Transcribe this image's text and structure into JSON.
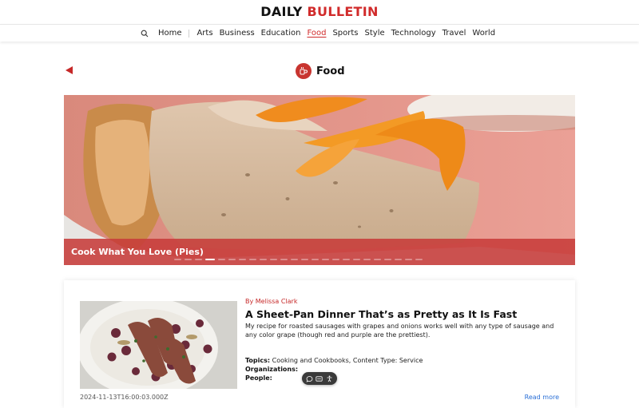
{
  "masthead": {
    "part1": "DAILY ",
    "part2": "BULLETIN"
  },
  "nav": {
    "home": "Home",
    "items": [
      "Arts",
      "Business",
      "Education",
      "Food",
      "Sports",
      "Style",
      "Technology",
      "Travel",
      "World"
    ],
    "active": "Food"
  },
  "section": {
    "title": "Food",
    "icon": "food-icon"
  },
  "hero": {
    "caption": "Cook What You Love (Pies)",
    "slide_count": 24,
    "active_slide": 3
  },
  "article": {
    "byline": "By Melissa Clark",
    "headline": "A Sheet-Pan Dinner That’s as Pretty as It Is Fast",
    "summary": "My recipe for roasted sausages with grapes and onions works well with any type of sausage and any color grape (though red and purple are the prettiest).",
    "topics_label": "Topics:",
    "topics_value": " Cooking and Cookbooks, Content Type: Service",
    "organizations_label": "Organizations:",
    "people_label": "People:",
    "timestamp": "2024-11-13T16:00:03.000Z",
    "read_more": "Read more"
  },
  "colors": {
    "brand_red": "#d12b2b",
    "link_blue": "#2a6fd6"
  },
  "icons": [
    "search-icon",
    "back-arrow-icon",
    "food-icon",
    "chat-icon",
    "caption-icon",
    "accessibility-icon"
  ]
}
